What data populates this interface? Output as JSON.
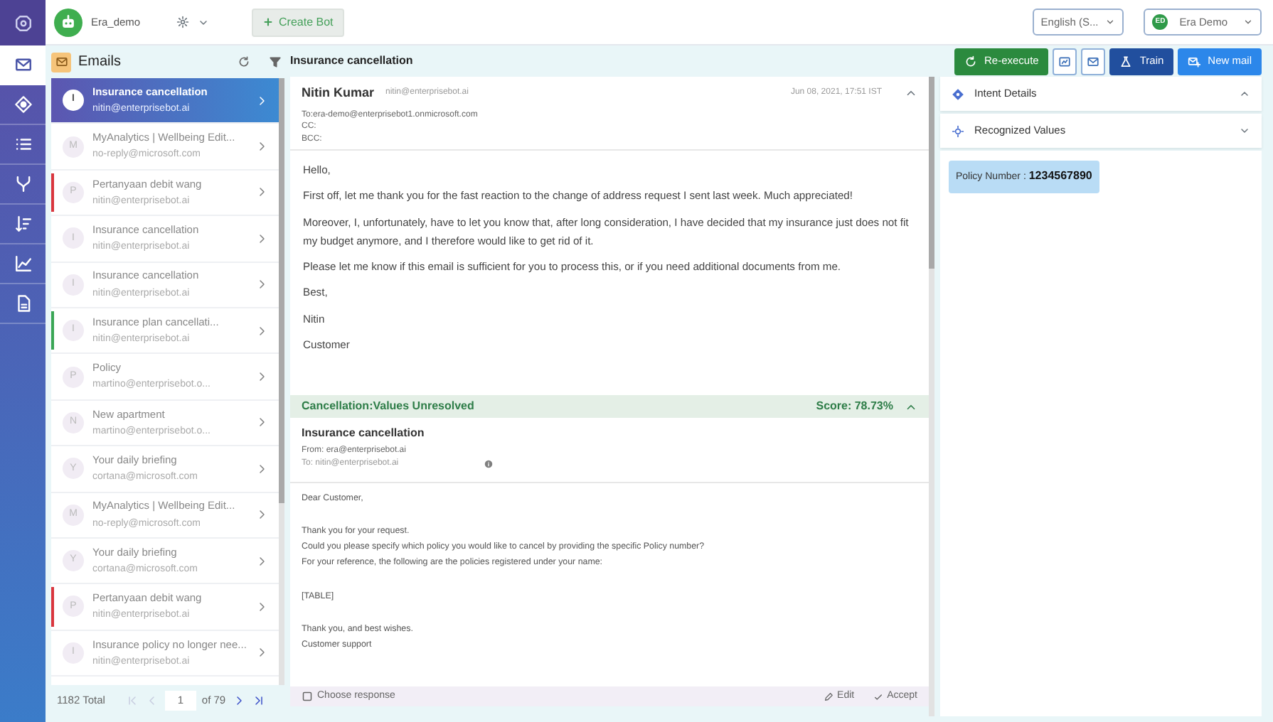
{
  "nav_rail": {
    "items": [
      {
        "kind": "mail",
        "selected": true
      },
      {
        "kind": "target",
        "selected": false
      },
      {
        "kind": "list",
        "selected": false
      },
      {
        "kind": "fork",
        "selected": false
      },
      {
        "kind": "sort",
        "selected": false
      },
      {
        "kind": "chart",
        "selected": false
      },
      {
        "kind": "document",
        "selected": false
      }
    ]
  },
  "top_bar": {
    "bot_name": "Era_demo",
    "create_bot": "Create Bot",
    "language": "English (S...",
    "user_initials": "ED",
    "user_name": "Era Demo"
  },
  "email_list": {
    "title": "Emails",
    "items": [
      {
        "initial": "I",
        "subject": "Insurance cancellation",
        "sender": "nitin@enterprisebot.ai",
        "selected": true
      },
      {
        "initial": "M",
        "subject": "MyAnalytics | Wellbeing Edit...",
        "sender": "no-reply@microsoft.com",
        "selected": false
      },
      {
        "initial": "P",
        "subject": "Pertanyaan debit wang",
        "sender": "nitin@enterprisebot.ai",
        "selected": false,
        "color": "#d9363e"
      },
      {
        "initial": "I",
        "subject": "Insurance cancellation",
        "sender": "nitin@enterprisebot.ai",
        "selected": false
      },
      {
        "initial": "I",
        "subject": "Insurance cancellation",
        "sender": "nitin@enterprisebot.ai",
        "selected": false
      },
      {
        "initial": "I",
        "subject": "Insurance plan cancellati...",
        "sender": "nitin@enterprisebot.ai",
        "selected": false,
        "color": "#3aa655"
      },
      {
        "initial": "P",
        "subject": "Policy",
        "sender": "martino@enterprisebot.o...",
        "selected": false
      },
      {
        "initial": "N",
        "subject": "New apartment",
        "sender": "martino@enterprisebot.o...",
        "selected": false
      },
      {
        "initial": "Y",
        "subject": "Your daily briefing",
        "sender": "cortana@microsoft.com",
        "selected": false
      },
      {
        "initial": "M",
        "subject": "MyAnalytics | Wellbeing Edit...",
        "sender": "no-reply@microsoft.com",
        "selected": false
      },
      {
        "initial": "Y",
        "subject": "Your daily briefing",
        "sender": "cortana@microsoft.com",
        "selected": false
      },
      {
        "initial": "P",
        "subject": "Pertanyaan debit wang",
        "sender": "nitin@enterprisebot.ai",
        "selected": false,
        "color": "#d9363e"
      },
      {
        "initial": "I",
        "subject": "Insurance policy no longer nee...",
        "sender": "nitin@enterprisebot.ai",
        "selected": false
      }
    ],
    "total": "1182 Total",
    "pager": {
      "prev_buttons": [
        {
          "kind": "first",
          "disabled": true
        },
        {
          "kind": "prev",
          "disabled": true
        }
      ],
      "page": "1",
      "of": "of 79",
      "next_buttons": [
        {
          "kind": "next",
          "disabled": false
        },
        {
          "kind": "last",
          "disabled": false
        }
      ]
    }
  },
  "message": {
    "title": "Insurance cancellation",
    "sender_name": "Nitin Kumar",
    "sender_email": "nitin@enterprisebot.ai",
    "date": "Jun 08, 2021, 17:51 IST",
    "expanded": true,
    "to": "To:era-demo@enterprisebot1.onmicrosoft.com",
    "cc": "CC:",
    "bcc": "BCC:",
    "body": [
      "Hello,",
      "First off, let me thank you for the fast reaction to the change of address request I sent last week. Much appreciated!",
      "Moreover, I, unfortunately, have to let you know that, after long consideration, I have decided that my insurance just does not fit my budget anymore, and I therefore would like to get rid of it.",
      "Please let me know if this email is sufficient for you to process this, or if you need additional documents from me.",
      "Best,",
      "Nitin",
      "Customer"
    ]
  },
  "response": {
    "intent": "Cancellation:Values Unresolved",
    "score": "Score: 78.73%",
    "expanded": true,
    "subject": "Insurance cancellation",
    "from": "From: era@enterprisebot.ai",
    "to": "To: nitin@enterprisebot.ai",
    "body_blocks": [
      [
        "Dear Customer,"
      ],
      [
        "Thank you for your request.",
        "Could you please specify which policy you would like to cancel by providing the specific Policy number?",
        "For your reference, the following are the policies registered under your name:"
      ],
      [
        "[TABLE]"
      ],
      [
        "Thank you, and best wishes.",
        "Customer support"
      ]
    ],
    "choose": "Choose response",
    "choose_checked": false,
    "edit": "Edit",
    "accept": "Accept"
  },
  "actions": [
    {
      "kind": "reexecute",
      "label": "Re-execute"
    },
    {
      "kind": "image"
    },
    {
      "kind": "mail"
    },
    {
      "kind": "train",
      "label": "Train"
    },
    {
      "kind": "new_mail",
      "label": "New mail"
    }
  ],
  "details": {
    "sections": [
      {
        "kind": "intent",
        "title": "Intent Details",
        "expanded": true
      },
      {
        "kind": "recognized",
        "title": "Recognized Values",
        "expanded": false
      }
    ],
    "values": [
      {
        "label": "Policy Number : ",
        "value": "1234567890"
      }
    ]
  }
}
